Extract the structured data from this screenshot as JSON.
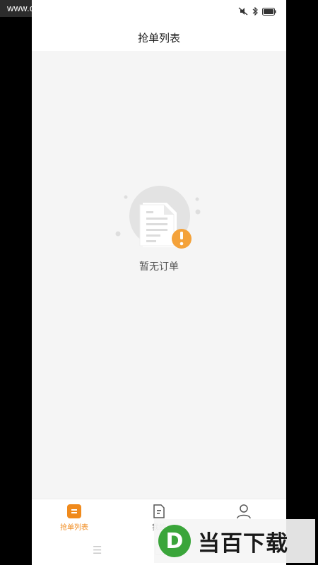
{
  "title": "抢单列表",
  "empty": {
    "message": "暂无订单",
    "icon": "empty-document-icon"
  },
  "tabs": [
    {
      "label": "抢单列表",
      "icon": "order-list-icon",
      "active": true
    },
    {
      "label": "我的",
      "icon": "my-orders-icon",
      "active": false
    },
    {
      "label": "",
      "icon": "user-icon",
      "active": false
    }
  ],
  "watermark": {
    "site": "www.downbai.com",
    "logo_letter": "D",
    "logo_text": "当百下载"
  },
  "colors": {
    "accent": "#f08a1c",
    "background": "#f5f5f5",
    "logo_green": "#3aa53a"
  }
}
